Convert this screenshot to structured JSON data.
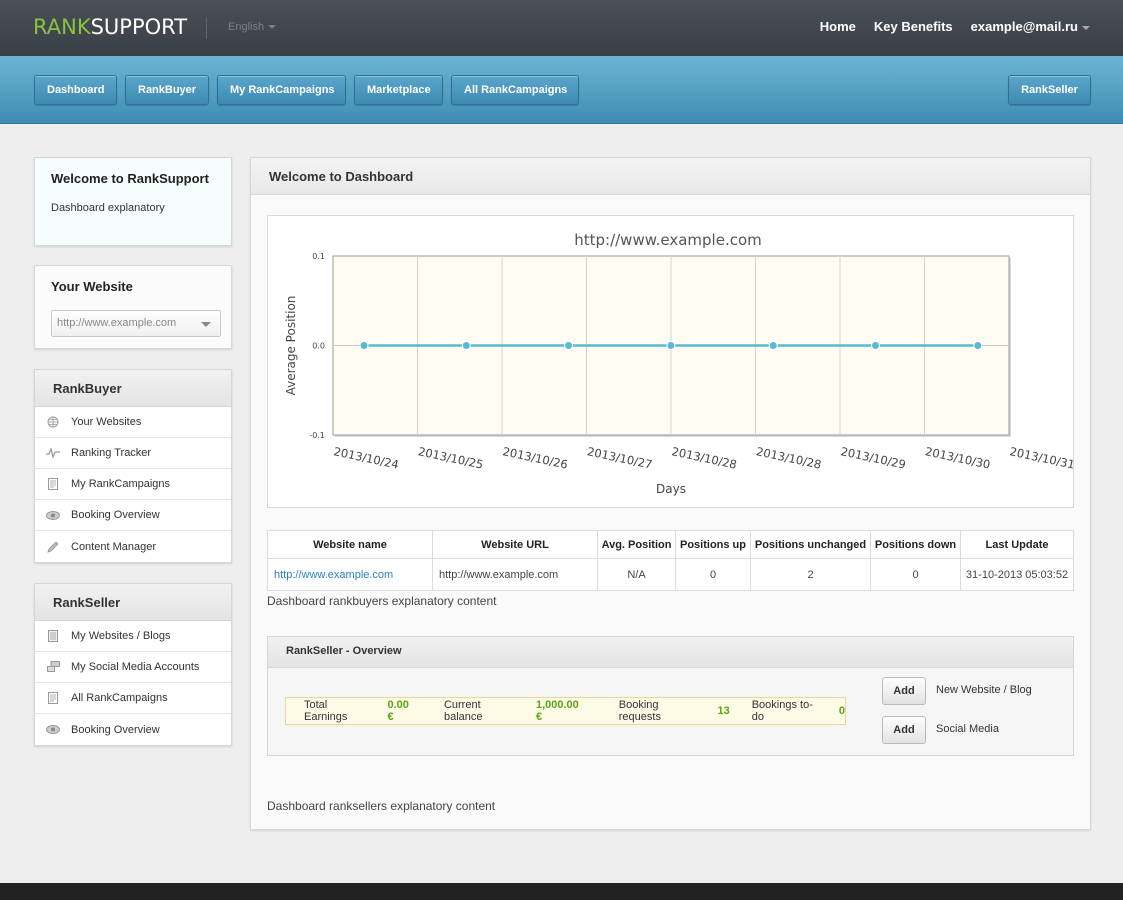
{
  "brand": {
    "part1": "RANK",
    "part2": "SUPPORT"
  },
  "language": "English",
  "topnav": {
    "home": "Home",
    "benefits": "Key Benefits",
    "user": "example@mail.ru"
  },
  "nav": {
    "dashboard": "Dashboard",
    "rankbuyer": "RankBuyer",
    "my_campaigns": "My RankCampaigns",
    "marketplace": "Marketplace",
    "all_campaigns": "All RankCampaigns",
    "rankseller": "RankSeller"
  },
  "welcome": {
    "title": "Welcome to RankSupport",
    "text": "Dashboard explanatory"
  },
  "your_website": {
    "title": "Your Website",
    "selected": "http://www.example.com"
  },
  "rankbuyer_menu": {
    "title": "RankBuyer",
    "items": [
      {
        "label": "Your Websites",
        "icon": "globe-icon"
      },
      {
        "label": "Ranking Tracker",
        "icon": "pulse-icon"
      },
      {
        "label": "My RankCampaigns",
        "icon": "document-icon"
      },
      {
        "label": "Booking Overview",
        "icon": "eye-icon"
      },
      {
        "label": "Content Manager",
        "icon": "pencil-icon"
      }
    ]
  },
  "rankseller_menu": {
    "title": "RankSeller",
    "items": [
      {
        "label": "My Websites / Blogs",
        "icon": "page-icon"
      },
      {
        "label": "My Social Media Accounts",
        "icon": "chat-icon"
      },
      {
        "label": "All RankCampaigns",
        "icon": "document-icon"
      },
      {
        "label": "Booking Overview",
        "icon": "eye-icon"
      }
    ]
  },
  "main": {
    "title": "Welcome to Dashboard"
  },
  "chart_data": {
    "type": "line",
    "title": "http://www.example.com",
    "xlabel": "Days",
    "ylabel": "Average Position",
    "x": [
      "2013/10/24",
      "2013/10/25",
      "2013/10/26",
      "2013/10/27",
      "2013/10/28",
      "2013/10/28",
      "2013/10/29",
      "2013/10/30",
      "2013/10/31"
    ],
    "series": [
      {
        "values": [
          0,
          0,
          0,
          0,
          0,
          0,
          0
        ]
      }
    ],
    "yticks": [
      "0.1",
      "0.0",
      "-0.1"
    ],
    "ylim": [
      -0.1,
      0.1
    ],
    "grid": true,
    "color": "#5bb8d2",
    "plot_bg": "#fffdf3"
  },
  "table": {
    "headers": [
      "Website name",
      "Website URL",
      "Avg. Position",
      "Positions up",
      "Positions unchanged",
      "Positions down",
      "Last Update"
    ],
    "rows": [
      [
        "http://www.example.com",
        "http://www.example.com",
        "N/A",
        "0",
        "2",
        "0",
        "31-10-2013 05:03:52"
      ]
    ]
  },
  "buyers_explain": "Dashboard rankbuyers explanatory content",
  "rs_overview": {
    "title": "RankSeller - Overview",
    "total_earnings_label": "Total Earnings",
    "total_earnings": "0.00 €",
    "balance_label": "Current balance",
    "balance": "1,000.00 €",
    "requests_label": "Booking requests",
    "requests": "13",
    "todo_label": "Bookings to-do",
    "todo": "0",
    "add_label": "Add",
    "add_website": "New Website / Blog",
    "add_social": "Social Media"
  },
  "sellers_explain": "Dashboard ranksellers explanatory content"
}
